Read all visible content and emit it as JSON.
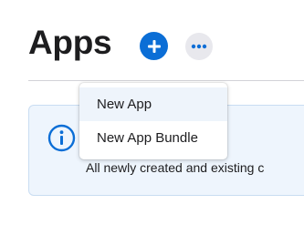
{
  "header": {
    "title": "Apps"
  },
  "actions": {
    "add_icon": "plus-icon",
    "more_icon": "ellipsis-icon"
  },
  "add_menu": {
    "items": [
      {
        "label": "New App",
        "highlighted": true
      },
      {
        "label": "New App Bundle",
        "highlighted": false
      }
    ]
  },
  "notice": {
    "icon": "info-icon",
    "text": "All newly created and existing c"
  },
  "colors": {
    "accent": "#0b6ed6",
    "info_background": "#eef5fd",
    "info_border": "#c9ddf2"
  }
}
